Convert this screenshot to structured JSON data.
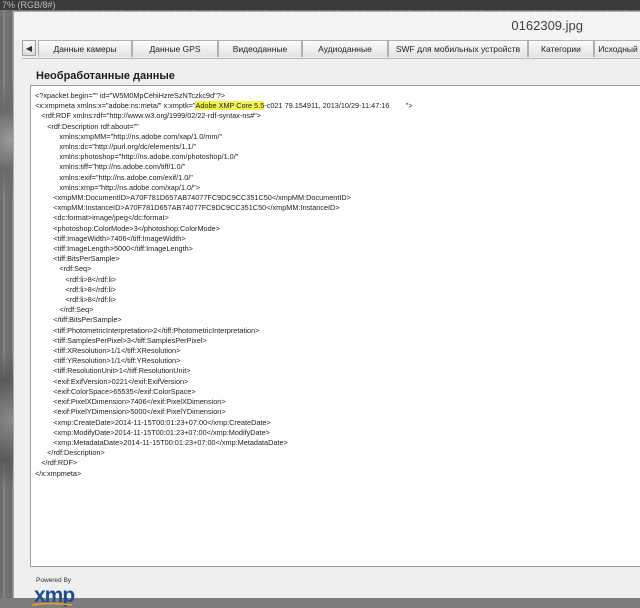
{
  "app": {
    "top_strip": "7% (RGB/8#)",
    "window_title": "0162309.jpg"
  },
  "tabs": [
    {
      "label": "Данные камеры"
    },
    {
      "label": "Данные GPS"
    },
    {
      "label": "Видеоданные"
    },
    {
      "label": "Аудиоданные"
    },
    {
      "label": "SWF для мобильных устройств"
    },
    {
      "label": "Категории"
    },
    {
      "label": "Исходный"
    }
  ],
  "raw": {
    "heading": "Необработанные данные",
    "lines": [
      "<?xpacket begin=\"\" id=\"W5M0MpCehiHzreSzNTczkc9d\"?>",
      "<x:xmpmeta xmlns:x=\"adobe:ns:meta/\" x:xmptk=\"",
      "   <rdf:RDF xmlns:rdf=\"http://www.w3.org/1999/02/22-rdf-syntax-ns#\">",
      "      <rdf:Description rdf:about=\"\"",
      "            xmlns:xmpMM=\"http://ns.adobe.com/xap/1.0/mm/\"",
      "            xmlns:dc=\"http://purl.org/dc/elements/1.1/\"",
      "            xmlns:photoshop=\"http://ns.adobe.com/photoshop/1.0/\"",
      "            xmlns:tiff=\"http://ns.adobe.com/tiff/1.0/\"",
      "            xmlns:exif=\"http://ns.adobe.com/exif/1.0/\"",
      "            xmlns:xmp=\"http://ns.adobe.com/xap/1.0/\">",
      "         <xmpMM:DocumentID>A70F781D657AB74077FC9DC9CC351C50</xmpMM:DocumentID>",
      "         <xmpMM:InstanceID>A70F781D657AB74077FC9DC9CC351C50</xmpMM:InstanceID>",
      "         <dc:format>image/jpeg</dc:format>",
      "         <photoshop:ColorMode>3</photoshop:ColorMode>",
      "         <tiff:ImageWidth>7406</tiff:ImageWidth>",
      "         <tiff:ImageLength>5000</tiff:ImageLength>",
      "         <tiff:BitsPerSample>",
      "            <rdf:Seq>",
      "               <rdf:li>8</rdf:li>",
      "               <rdf:li>8</rdf:li>",
      "               <rdf:li>8</rdf:li>",
      "            </rdf:Seq>",
      "         </tiff:BitsPerSample>",
      "         <tiff:PhotometricInterpretation>2</tiff:PhotometricInterpretation>",
      "         <tiff:SamplesPerPixel>3</tiff:SamplesPerPixel>",
      "         <tiff:XResolution>1/1</tiff:XResolution>",
      "         <tiff:YResolution>1/1</tiff:YResolution>",
      "         <tiff:ResolutionUnit>1</tiff:ResolutionUnit>",
      "         <exif:ExifVersion>0221</exif:ExifVersion>",
      "         <exif:ColorSpace>65535</exif:ColorSpace>",
      "         <exif:PixelXDimension>7406</exif:PixelXDimension>",
      "         <exif:PixelYDimension>5000</exif:PixelYDimension>",
      "         <xmp:CreateDate>2014-11-15T00:01:23+07:00</xmp:CreateDate>",
      "         <xmp:ModifyDate>2014-11-15T00:01:23+07:00</xmp:ModifyDate>",
      "         <xmp:MetadataDate>2014-11-15T00:01:23+07:00</xmp:MetadataDate>",
      "      </rdf:Description>",
      "   </rdf:RDF>",
      "</x:xmpmeta>"
    ],
    "line2_highlight": "Adobe XMP Core 5.5",
    "line2_tail": "-c021 79.154911, 2013/10/29-11:47:16        \">"
  },
  "footer": {
    "powered_by": "Powered By",
    "logo_text": "xmp"
  },
  "colors": {
    "highlight": "#f2f250",
    "xmp_blue": "#1d4f91",
    "xmp_orange": "#f19a1c"
  }
}
